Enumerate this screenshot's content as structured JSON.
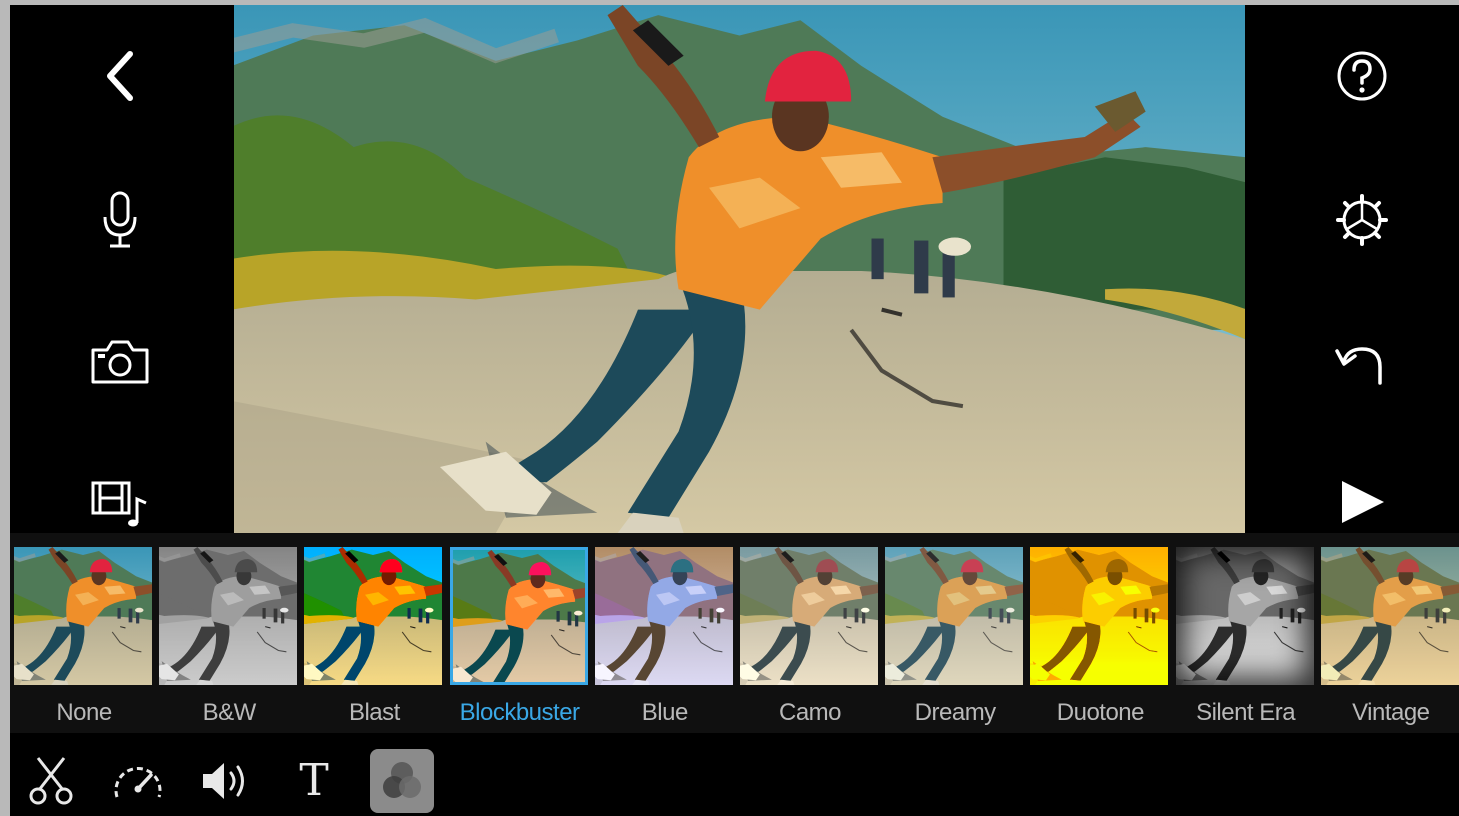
{
  "left_toolbar": {
    "items": [
      {
        "icon": "back-chevron-icon"
      },
      {
        "icon": "microphone-icon"
      },
      {
        "icon": "camera-icon"
      },
      {
        "icon": "film-music-icon"
      }
    ]
  },
  "right_toolbar": {
    "items": [
      {
        "icon": "help-icon"
      },
      {
        "icon": "settings-gear-icon"
      },
      {
        "icon": "undo-icon"
      },
      {
        "icon": "play-icon"
      }
    ]
  },
  "filters": {
    "selected": "Blockbuster",
    "items": [
      {
        "label": "None"
      },
      {
        "label": "B&W"
      },
      {
        "label": "Blast"
      },
      {
        "label": "Blockbuster"
      },
      {
        "label": "Blue"
      },
      {
        "label": "Camo"
      },
      {
        "label": "Dreamy"
      },
      {
        "label": "Duotone"
      },
      {
        "label": "Silent Era"
      },
      {
        "label": "Vintage"
      }
    ]
  },
  "bottom_toolbar": {
    "items": [
      {
        "icon": "scissors-icon"
      },
      {
        "icon": "speed-gauge-icon"
      },
      {
        "icon": "volume-icon"
      },
      {
        "icon": "text-title-icon",
        "glyph": "T"
      },
      {
        "icon": "filters-icon",
        "active": true
      }
    ]
  },
  "colors": {
    "accent": "#3aa8e6",
    "background": "#000000",
    "label": "#b9b9b9"
  }
}
